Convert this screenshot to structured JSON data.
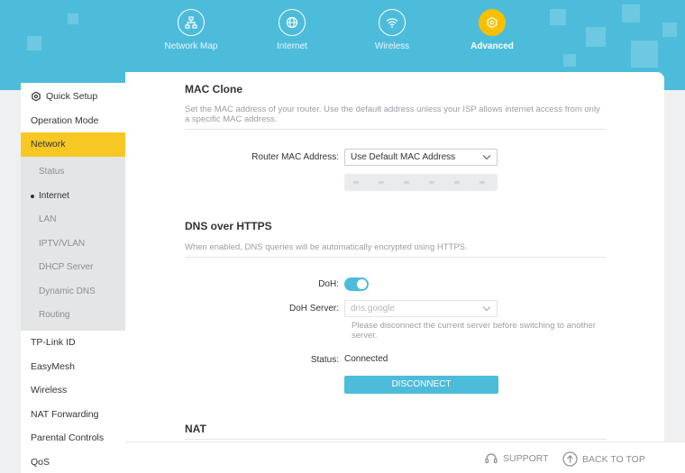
{
  "header": {
    "tabs": [
      {
        "label": "Network Map",
        "icon": "network-map-icon"
      },
      {
        "label": "Internet",
        "icon": "globe-icon"
      },
      {
        "label": "Wireless",
        "icon": "wifi-icon"
      },
      {
        "label": "Advanced",
        "icon": "gear-icon",
        "active": true
      }
    ]
  },
  "sidebar": {
    "quick_setup": "Quick Setup",
    "operation_mode": "Operation Mode",
    "network": "Network",
    "network_sub": [
      "Status",
      "Internet",
      "LAN",
      "IPTV/VLAN",
      "DHCP Server",
      "Dynamic DNS",
      "Routing"
    ],
    "active_sub": "Internet",
    "items_after": [
      "TP-Link ID",
      "EasyMesh",
      "Wireless",
      "NAT Forwarding",
      "Parental Controls",
      "QoS"
    ]
  },
  "mac_clone": {
    "title": "MAC Clone",
    "description": "Set the MAC address of your router. Use the default address unless your ISP allows internet access from only a specific MAC address.",
    "router_mac_label": "Router MAC Address:",
    "router_mac_value": "Use Default MAC Address"
  },
  "dns_https": {
    "title": "DNS over HTTPS",
    "description": "When enabled, DNS queries will be automatically encrypted using HTTPS.",
    "doh_label": "DoH:",
    "doh_enabled": true,
    "server_label": "DoH Server:",
    "server_value": "dns.google",
    "server_note": "Please disconnect the current server before switching to another server.",
    "status_label": "Status:",
    "status_value": "Connected",
    "disconnect_button": "DISCONNECT"
  },
  "nat": {
    "title": "NAT"
  },
  "footer": {
    "support": "SUPPORT",
    "back_to_top": "BACK TO TOP"
  },
  "colors": {
    "accent": "#4dbcdb",
    "highlight": "#f7c823",
    "active_tab": "#f7c000"
  }
}
